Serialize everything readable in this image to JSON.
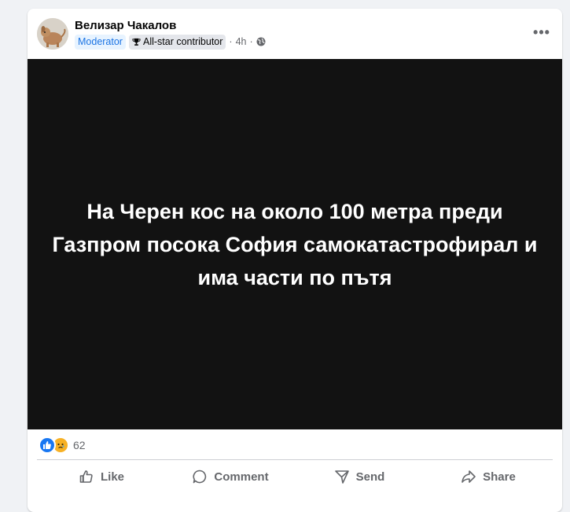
{
  "post": {
    "author": "Велизар Чакалов",
    "badge_moderator": "Moderator",
    "badge_contributor": "All-star contributor",
    "separator": "·",
    "time": "4h",
    "image_text": "На Черен кос на около 100 метра преди Газпром посока София самокатастрофирал и има части по пътя",
    "more_label": "•••"
  },
  "reactions": {
    "types": [
      "like-icon",
      "sad-icon"
    ],
    "count": "62"
  },
  "actions": [
    {
      "label": "Like",
      "icon": "thumbs-up-icon"
    },
    {
      "label": "Comment",
      "icon": "comment-icon"
    },
    {
      "label": "Send",
      "icon": "send-icon"
    },
    {
      "label": "Share",
      "icon": "share-icon"
    }
  ],
  "colors": {
    "media_background": "#121212",
    "moderator_text": "#1b74e4",
    "like_blue": "#1877f2",
    "sad_yellow": "#f7b125"
  }
}
